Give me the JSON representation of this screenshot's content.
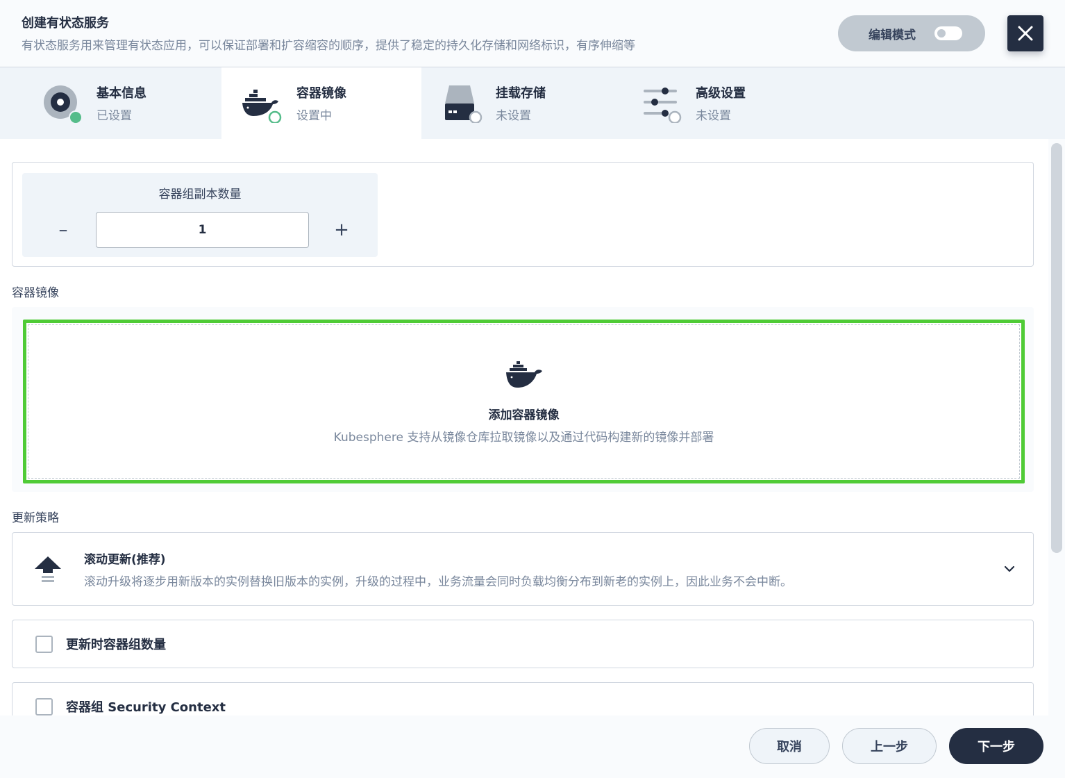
{
  "header": {
    "title": "创建有状态服务",
    "description": "有状态服务用来管理有状态应用，可以保证部署和扩容缩容的顺序，提供了稳定的持久化存储和网络标识，有序伸缩等",
    "edit_mode_label": "编辑模式",
    "edit_mode_on": false
  },
  "steps": [
    {
      "title": "基本信息",
      "status": "已设置",
      "icon": "disk-icon",
      "state": "done"
    },
    {
      "title": "容器镜像",
      "status": "设置中",
      "icon": "docker-icon",
      "state": "active"
    },
    {
      "title": "挂载存储",
      "status": "未设置",
      "icon": "storage-icon",
      "state": "pending"
    },
    {
      "title": "高级设置",
      "status": "未设置",
      "icon": "sliders-icon",
      "state": "pending"
    }
  ],
  "replicas": {
    "label": "容器组副本数量",
    "value": "1",
    "minus_symbol": "–",
    "plus_symbol": "+"
  },
  "container_image": {
    "section_label": "容器镜像",
    "add_title": "添加容器镜像",
    "add_desc": "Kubesphere 支持从镜像仓库拉取镜像以及通过代码构建新的镜像并部署",
    "highlight_color": "#4fcb36"
  },
  "update_strategy": {
    "section_label": "更新策略",
    "title": "滚动更新(推荐)",
    "desc": "滚动升级将逐步用新版本的实例替换旧版本的实例，升级的过程中，业务流量会同时负载均衡分布到新老的实例上，因此业务不会中断。"
  },
  "options": [
    {
      "label": "更新时容器组数量",
      "checked": false
    },
    {
      "label": "容器组 Security Context",
      "checked": false
    }
  ],
  "footer": {
    "cancel": "取消",
    "prev": "上一步",
    "next": "下一步"
  },
  "colors": {
    "primary_dark": "#242e42",
    "success_green": "#55bc8a",
    "muted_text": "#79879c"
  }
}
